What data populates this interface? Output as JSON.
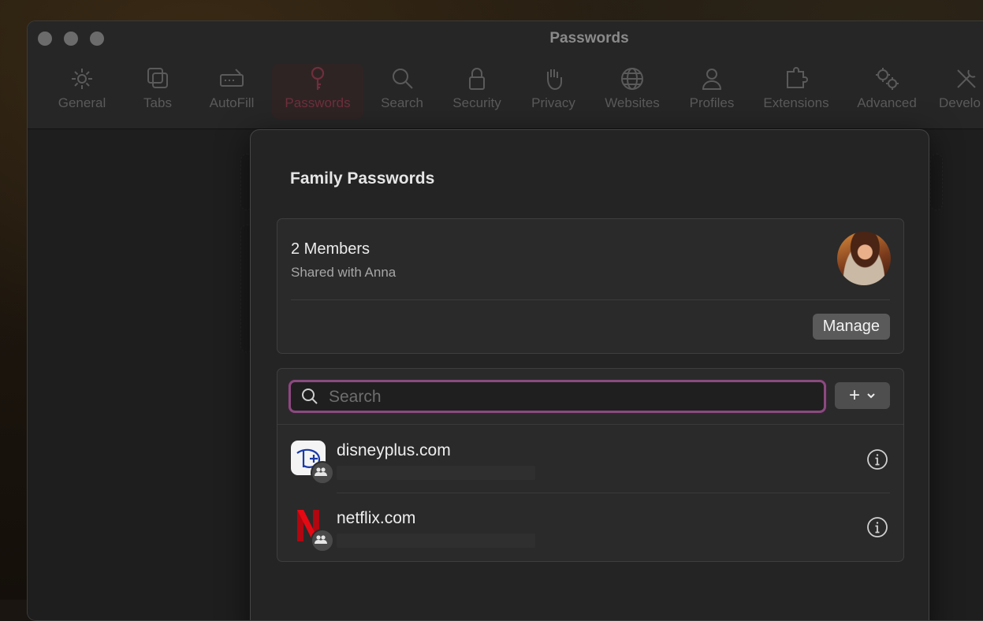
{
  "window": {
    "title": "Passwords"
  },
  "toolbar": {
    "items": [
      {
        "label": "General",
        "icon": "gear-icon"
      },
      {
        "label": "Tabs",
        "icon": "tabs-icon"
      },
      {
        "label": "AutoFill",
        "icon": "autofill-icon"
      },
      {
        "label": "Passwords",
        "icon": "key-icon",
        "active": true
      },
      {
        "label": "Search",
        "icon": "magnifier-icon"
      },
      {
        "label": "Security",
        "icon": "lock-icon"
      },
      {
        "label": "Privacy",
        "icon": "hand-icon"
      },
      {
        "label": "Websites",
        "icon": "globe-icon"
      },
      {
        "label": "Profiles",
        "icon": "person-icon"
      },
      {
        "label": "Extensions",
        "icon": "puzzle-icon"
      },
      {
        "label": "Advanced",
        "icon": "gears-icon"
      },
      {
        "label": "Develo",
        "icon": "tools-icon"
      }
    ]
  },
  "sheet": {
    "title": "Family Passwords",
    "members": {
      "count_label": "2 Members",
      "shared_label": "Shared with Anna",
      "manage_label": "Manage"
    },
    "search": {
      "placeholder": "Search",
      "value": ""
    },
    "add_button": {
      "label": "+"
    },
    "entries": [
      {
        "site": "disneyplus.com",
        "icon": "disney-plus-icon",
        "shared": true
      },
      {
        "site": "netflix.com",
        "icon": "netflix-icon",
        "shared": true
      }
    ]
  },
  "colors": {
    "accent_focus": "#8a4a7f",
    "window_bg": "#1e1e1e",
    "sheet_bg": "#242424",
    "active_tool": "#6e2f3c"
  }
}
